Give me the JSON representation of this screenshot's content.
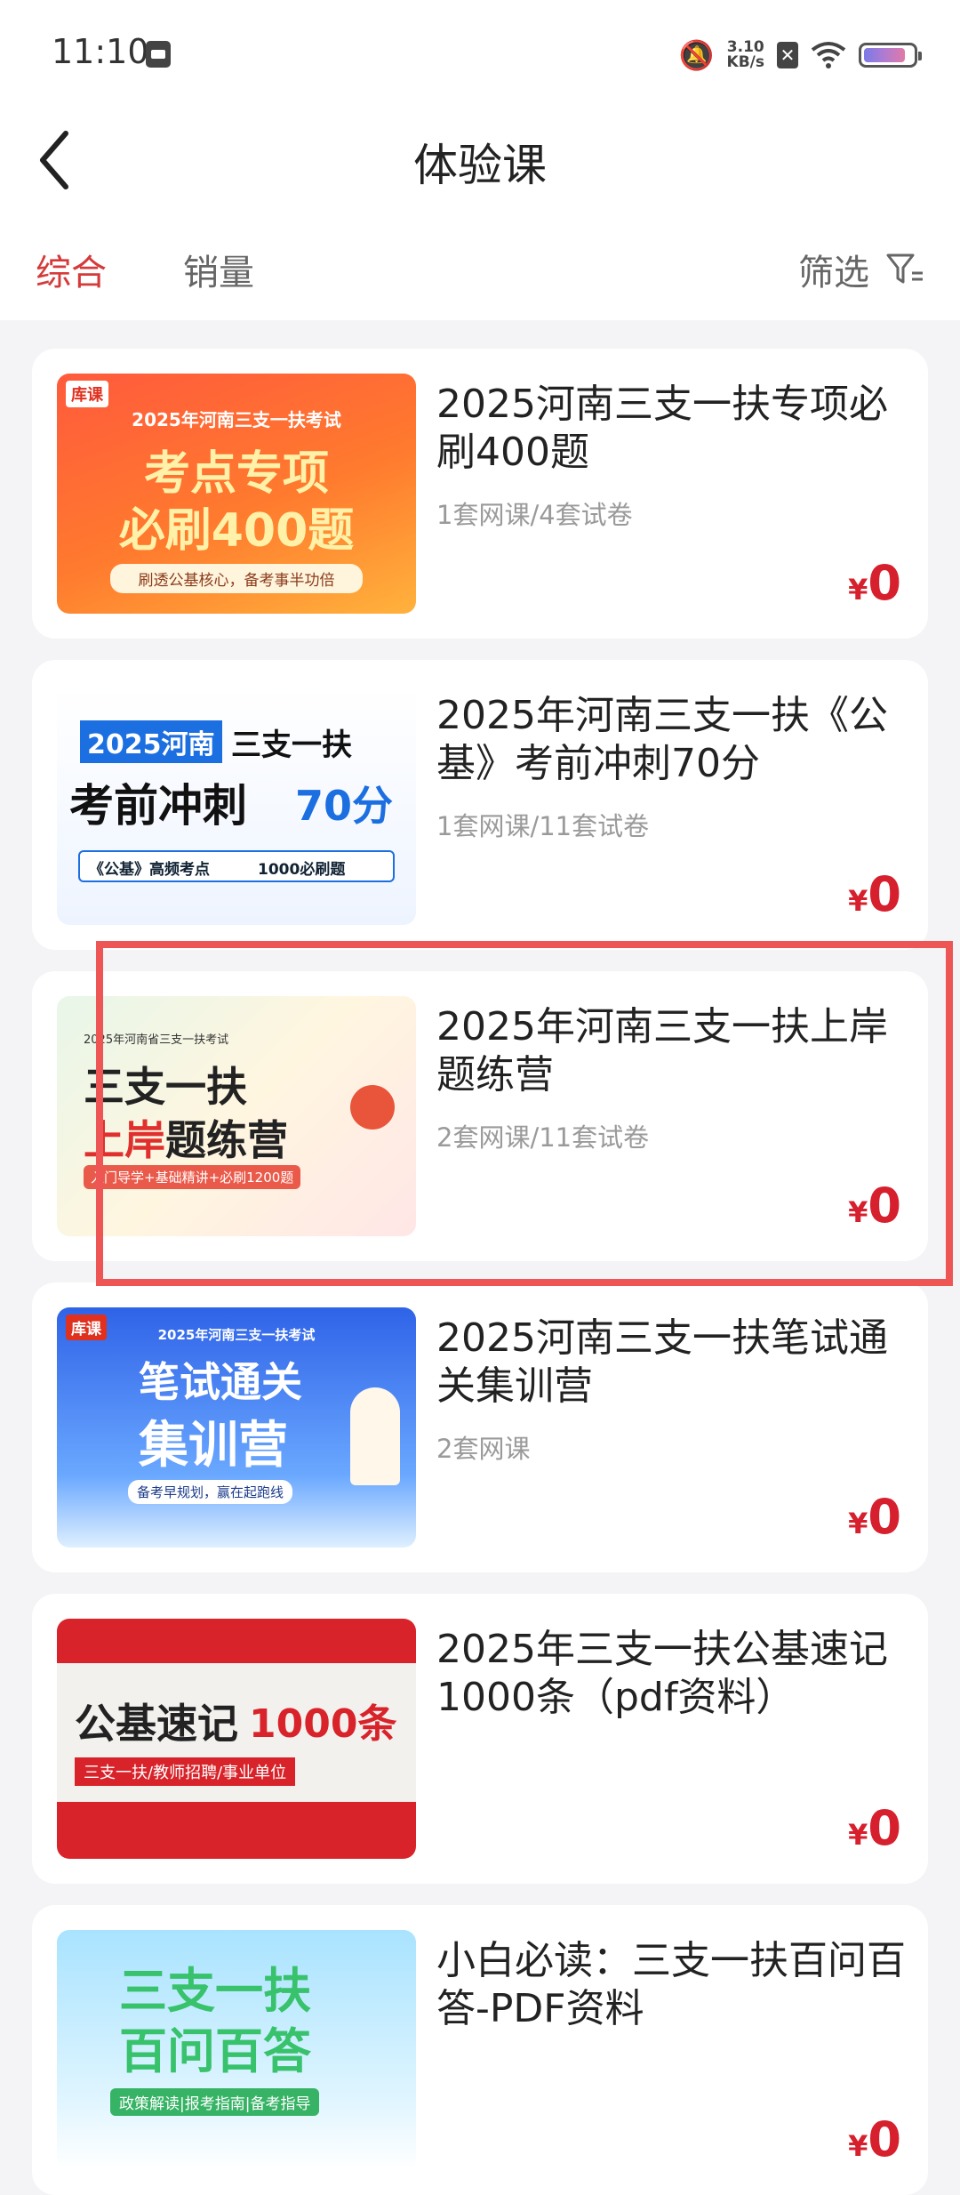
{
  "status_bar": {
    "time": "11:10",
    "net_speed_value": "3.10",
    "net_speed_unit": "KB/s",
    "battery_level": 0.85
  },
  "nav": {
    "title": "体验课"
  },
  "tabs": [
    {
      "label": "综合",
      "active": true
    },
    {
      "label": "销量",
      "active": false
    }
  ],
  "filter": {
    "label": "筛选"
  },
  "courses": [
    {
      "title": "2025河南三支一扶专项必刷400题",
      "meta": "1套网课/4套试卷",
      "price_symbol": "¥",
      "price": "0",
      "thumb": {
        "brand": "库课",
        "lines": [
          "2025年河南三支一扶考试",
          "考点专项",
          "必刷400题",
          "刷透公基核心，备考事半功倍"
        ]
      }
    },
    {
      "title": "2025年河南三支一扶《公基》考前冲刺70分",
      "meta": "1套网课/11套试卷",
      "price_symbol": "¥",
      "price": "0",
      "thumb": {
        "lines": [
          "2025河南",
          "三支一扶",
          "考前冲刺",
          "70分",
          "《公基》高频考点",
          "1000必刷题"
        ]
      }
    },
    {
      "title": "2025年河南三支一扶上岸题练营",
      "meta": "2套网课/11套试卷",
      "price_symbol": "¥",
      "price": "0",
      "thumb": {
        "lines": [
          "2025年河南省三支一扶考试",
          "三支一扶",
          "上岸",
          "题练营",
          "入门导学+基础精讲+必刷1200题"
        ]
      }
    },
    {
      "title": "2025河南三支一扶笔试通关集训营",
      "meta": "2套网课",
      "price_symbol": "¥",
      "price": "0",
      "thumb": {
        "brand": "库课",
        "lines": [
          "2025年河南三支一扶考试",
          "笔试通关",
          "集训营",
          "备考早规划，赢在起跑线"
        ]
      }
    },
    {
      "title": "2025年三支一扶公基速记1000条（pdf资料）",
      "meta": "",
      "price_symbol": "¥",
      "price": "0",
      "thumb": {
        "lines": [
          "公基速记",
          "1000条",
          "三支一扶/教师招聘/事业单位"
        ]
      }
    },
    {
      "title": "小白必读：三支一扶百问百答-PDF资料",
      "meta": "",
      "price_symbol": "¥",
      "price": "0",
      "thumb": {
        "lines": [
          "三支一扶",
          "百问百答",
          "政策解读|报考指南|备考指导"
        ]
      }
    }
  ],
  "colors": {
    "accent": "#d53a3a",
    "price": "#d6202d",
    "highlight": "#ee5555",
    "background": "#f4f4f6"
  }
}
